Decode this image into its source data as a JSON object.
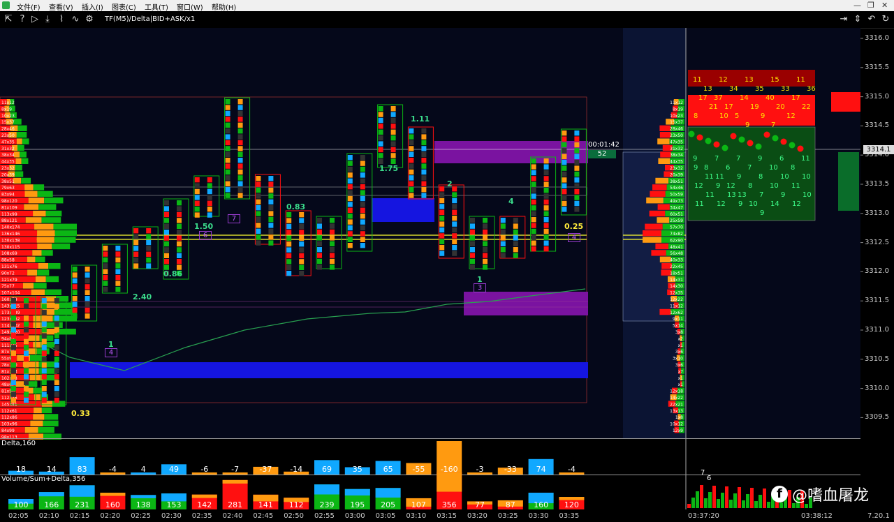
{
  "menu": [
    "文件(F)",
    "查看(V)",
    "插入(I)",
    "图表(C)",
    "工具(T)",
    "窗口(W)",
    "帮助(H)"
  ],
  "window_controls": [
    "—",
    "❐",
    "✕"
  ],
  "toolbar": {
    "title": "TF(M5)/Delta|BID+ASK/x1",
    "icons": [
      "cursor-icon",
      "help-icon",
      "play-icon",
      "download-icon",
      "chart-icon",
      "settings-icon",
      "exit-icon",
      "move-vertical-icon",
      "undo-icon",
      "refresh-icon"
    ]
  },
  "price_axis": [
    "3316.0",
    "3315.5",
    "3315.0",
    "3314.5",
    "3314.0",
    "3313.5",
    "3313.0",
    "3312.5",
    "3312.0",
    "3311.5",
    "3311.0",
    "3310.5",
    "3310.0",
    "3309.5"
  ],
  "current_price": "3314.1",
  "timer": {
    "countdown": "00:01:42",
    "volume": "52"
  },
  "bar_annotations": [
    "1",
    "0.33",
    "2.40",
    "0.86",
    "1.50",
    "0.83",
    "1.75",
    "1.11",
    "2",
    "1",
    "4",
    "0.25"
  ],
  "boxed_labels": [
    "4",
    "7",
    "6",
    "3",
    "4"
  ],
  "delta_pane": {
    "title": "Delta,160",
    "values": [
      "18",
      "14",
      "83",
      "-4",
      "4",
      "49",
      "-6",
      "-7",
      "-37",
      "-14",
      "69",
      "35",
      "65",
      "-55",
      "-160",
      "-3",
      "-33",
      "74",
      "-4"
    ]
  },
  "volume_pane": {
    "title": "Volume/Sum+Delta,356",
    "values": [
      "100",
      "166",
      "231",
      "160",
      "138",
      "153",
      "142",
      "281",
      "141",
      "112",
      "239",
      "195",
      "205",
      "107",
      "356",
      "77",
      "87",
      "160",
      "120"
    ]
  },
  "time_axis": [
    "02:05",
    "02:10",
    "02:15",
    "02:20",
    "02:25",
    "02:30",
    "02:35",
    "02:40",
    "02:45",
    "02:50",
    "02:55",
    "03:00",
    "03:05",
    "03:10",
    "03:15",
    "03:20",
    "03:25",
    "03:30",
    "03:35"
  ],
  "tick_panel": {
    "time_start": "03:37:20",
    "time_end": "03:38:12",
    "peak_labels": [
      "7",
      "6"
    ],
    "upper_numbers": [
      "11",
      "12",
      "13",
      "15",
      "11",
      "13",
      "34",
      "35",
      "33",
      "36",
      "37",
      "14",
      "40",
      "17",
      "17",
      "17",
      "19",
      "20",
      "22",
      "21",
      "5",
      "9",
      "12",
      "8",
      "10",
      "9",
      "7"
    ],
    "lower_numbers": [
      "9",
      "7",
      "7",
      "9",
      "6",
      "11",
      "8",
      "6",
      "7",
      "10",
      "8",
      "9",
      "11",
      "9",
      "8",
      "10",
      "10",
      "11",
      "12",
      "8",
      "10",
      "11",
      "12",
      "9",
      "13",
      "7",
      "9",
      "10",
      "11",
      "13",
      "10",
      "14",
      "12",
      "11",
      "12",
      "9",
      "9"
    ]
  },
  "volume_profile_labels": [
    "11x12",
    "8x19",
    "10x23",
    "15x37",
    "28x46",
    "23x50",
    "47x35",
    "31x32",
    "38x34",
    "44x35",
    "23x32",
    "20x39",
    "38x51",
    "79x63",
    "83x94",
    "98x120",
    "81x109",
    "113x99",
    "88x121",
    "140x174",
    "136x146",
    "130x138",
    "130x115",
    "108x69",
    "88x58",
    "131x76",
    "90x72",
    "121x79",
    "75x77",
    "107x104",
    "160x79",
    "143x115",
    "173x139",
    "123x162",
    "114x102",
    "149x120",
    "94x85",
    "111x75",
    "87x76",
    "55x95",
    "78x120",
    "81x113",
    "102x98",
    "48x67",
    "81x56",
    "112x46",
    "145x81",
    "112x61",
    "112x86",
    "103x96",
    "84x99",
    "98x113"
  ],
  "right_profile_labels": [
    "11x12",
    "8x19",
    "10x23",
    "15x37",
    "28x46",
    "23x50",
    "47x35",
    "31x32",
    "38x34",
    "44x35",
    "23x32",
    "20x39",
    "38x51",
    "54x46",
    "50x59",
    "49x73",
    "34x47",
    "60x51",
    "25x59",
    "57x70",
    "74x82",
    "62x90",
    "48x41",
    "56x48",
    "40x33",
    "22x45",
    "18x51",
    "14x31",
    "14x30",
    "12x35",
    "12x22",
    "11x12",
    "12x62",
    "9x11",
    "5x14",
    "3x8",
    "x2",
    "x1",
    "3x6",
    "3x10",
    "3x6",
    "x7",
    "x1",
    "x1",
    "12x18",
    "14x22",
    "22x21",
    "13x13",
    "1x8",
    "10x12",
    "12x9"
  ],
  "colors": {
    "background": "#000000",
    "chart_bg": "#070b1d",
    "buy": "#0bb614",
    "sell": "#ff1010",
    "neutral_up": "#10a8ff",
    "neutral_down": "#ff9a10",
    "highlight": "#ffff30",
    "profile_purple": "#7a13a0",
    "profile_blue": "#1515e0",
    "vwap": "#28a050"
  }
}
